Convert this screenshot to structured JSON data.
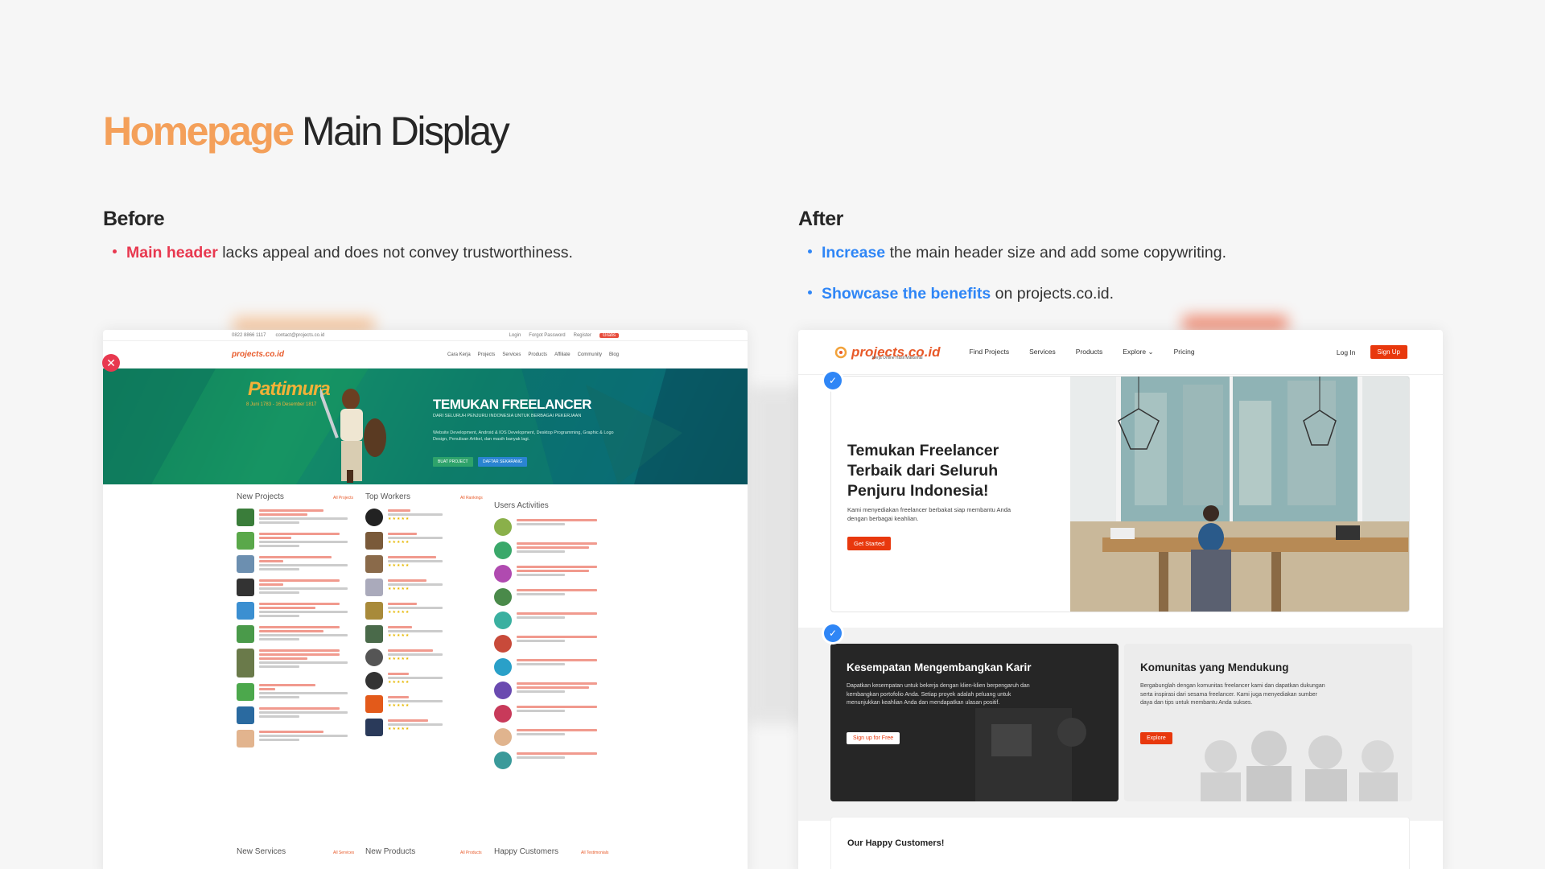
{
  "page": {
    "title_accent": "Homepage",
    "title_rest": "Main Display"
  },
  "before": {
    "heading": "Before",
    "bullet_highlight": "Main header",
    "bullet_text": "lacks appeal and does not convey trustworthiness.",
    "screenshot": {
      "topbar_phone": "0822 8866 1117",
      "topbar_email": "contact@projects.co.id",
      "topbar_login": "Login",
      "topbar_forgot": "Forgot Password",
      "topbar_register_label": "Register",
      "topbar_register_btn": "Gratis",
      "logo": "projects.co.id",
      "nav": [
        "Cara Kerja",
        "Projects",
        "Services",
        "Products",
        "Affiliate",
        "Community",
        "Blog"
      ],
      "hero_name": "Pattimura",
      "hero_dates": "8 Juni 1783 - 16 Desember 1817",
      "hero_title": "TEMUKAN FREELANCER",
      "hero_subtitle": "DARI SELURUH PENJURU INDONESIA UNTUK BERBAGAI PEKERJAAN",
      "hero_desc": "Website Development, Android & IOS Development, Desktop Programming, Graphic & Logo Design, Penulisan Artikel, dan masih banyak lagi.",
      "btn_create": "BUAT PROJECT",
      "btn_register": "DAFTAR SEKARANG",
      "sections": {
        "new_projects": "New Projects",
        "all_projects": "All Projects",
        "top_workers": "Top Workers",
        "all_rankings": "All Rankings",
        "users_activities": "Users Activities",
        "new_services": "New Services",
        "all_services": "All Services",
        "new_products": "New Products",
        "all_products": "All Products",
        "happy_customers": "Happy Customers",
        "all_testimonials": "All Testimonials"
      }
    }
  },
  "after": {
    "heading": "After",
    "bullet1_highlight": "Increase",
    "bullet1_text": "the main header size and add some copywriting.",
    "bullet2_highlight": "Showcase the benefits",
    "bullet2_text": "on projects.co.id.",
    "screenshot": {
      "logo": "projects.co.id",
      "logo_tagline": "Kerja Online Hasil Maksimal",
      "nav": [
        "Find Projects",
        "Services",
        "Products",
        "Explore",
        "Pricing"
      ],
      "login": "Log In",
      "signup": "Sign Up",
      "hero_title": "Temukan Freelancer Terbaik dari Seluruh Penjuru Indonesia!",
      "hero_desc": "Kami menyediakan freelancer berbakat siap membantu Anda dengan berbagai keahlian.",
      "hero_cta": "Get Started",
      "card1_title": "Kesempatan Mengembangkan Karir",
      "card1_desc": "Dapatkan kesempatan untuk bekerja dengan klien-klien berpengaruh dan kembangkan portofolio Anda. Setiap proyek adalah peluang untuk menunjukkan keahlian Anda dan mendapatkan ulasan positif.",
      "card1_cta": "Sign up for Free",
      "card2_title": "Komunitas yang Mendukung",
      "card2_desc": "Bergabunglah dengan komunitas freelancer kami dan dapatkan dukungan serta inspirasi dari sesama freelancer. Kami juga menyediakan sumber daya dan tips untuk membantu Anda sukses.",
      "card2_cta": "Explore",
      "customers_title": "Our Happy Customers!"
    }
  },
  "colors": {
    "accent_orange": "#f4a05a",
    "highlight_red": "#e8384f",
    "highlight_blue": "#2f86f6",
    "cta_orange": "#e8380d"
  }
}
